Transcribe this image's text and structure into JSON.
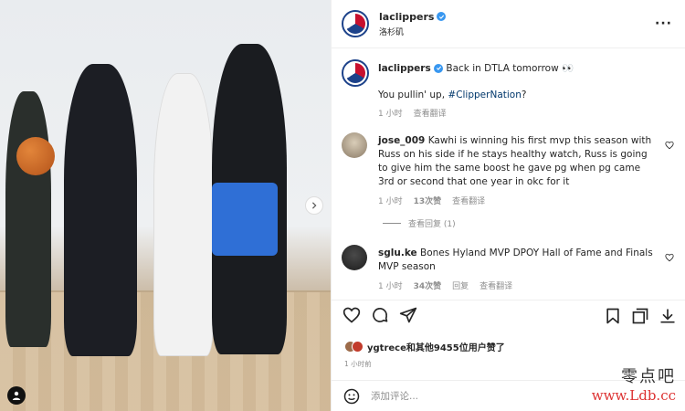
{
  "post": {
    "account": "laclippers",
    "location": "洛杉矶",
    "caption_text": "Back in DTLA tomorrow 👀",
    "caption_line2": "You pullin' up, ",
    "caption_hashtag": "#ClipperNation",
    "caption_q": "?",
    "caption_time": "1 小时",
    "caption_translate": "查看翻译"
  },
  "comments": [
    {
      "user": "jose_009",
      "text": "Kawhi is winning his first mvp this season with Russ on his side if he stays healthy watch, Russ is going to give him the same boost he gave pg when pg came 3rd or second that one year in okc for it",
      "time": "1 小时",
      "likes": "13次赞",
      "translate": "查看翻译",
      "view_replies": "查看回复 (1)"
    },
    {
      "user": "sglu.ke",
      "text": "Bones Hyland MVP DPOY Hall of Fame and Finals MVP season",
      "time": "1 小时",
      "likes": "34次赞",
      "reply": "回复",
      "translate": "查看翻译"
    }
  ],
  "liked_by": "ygtrece和其他9455位用户赞了",
  "post_age": "1 小时前",
  "add_comment_placeholder": "添加评论...",
  "watermark": {
    "line1": "零点吧",
    "line2": "www.Ldb.cc"
  },
  "icons": [
    "more-icon",
    "verified-icon",
    "heart-icon",
    "comment-icon",
    "share-icon",
    "save-icon",
    "fullscreen-icon",
    "download-icon",
    "emoji-icon",
    "tag-icon"
  ],
  "colors": {
    "link": "#00376b",
    "verified": "#3897f0",
    "muted": "#8e8e8e",
    "clippers_blue": "#1d428a",
    "clippers_red": "#c8102e"
  }
}
